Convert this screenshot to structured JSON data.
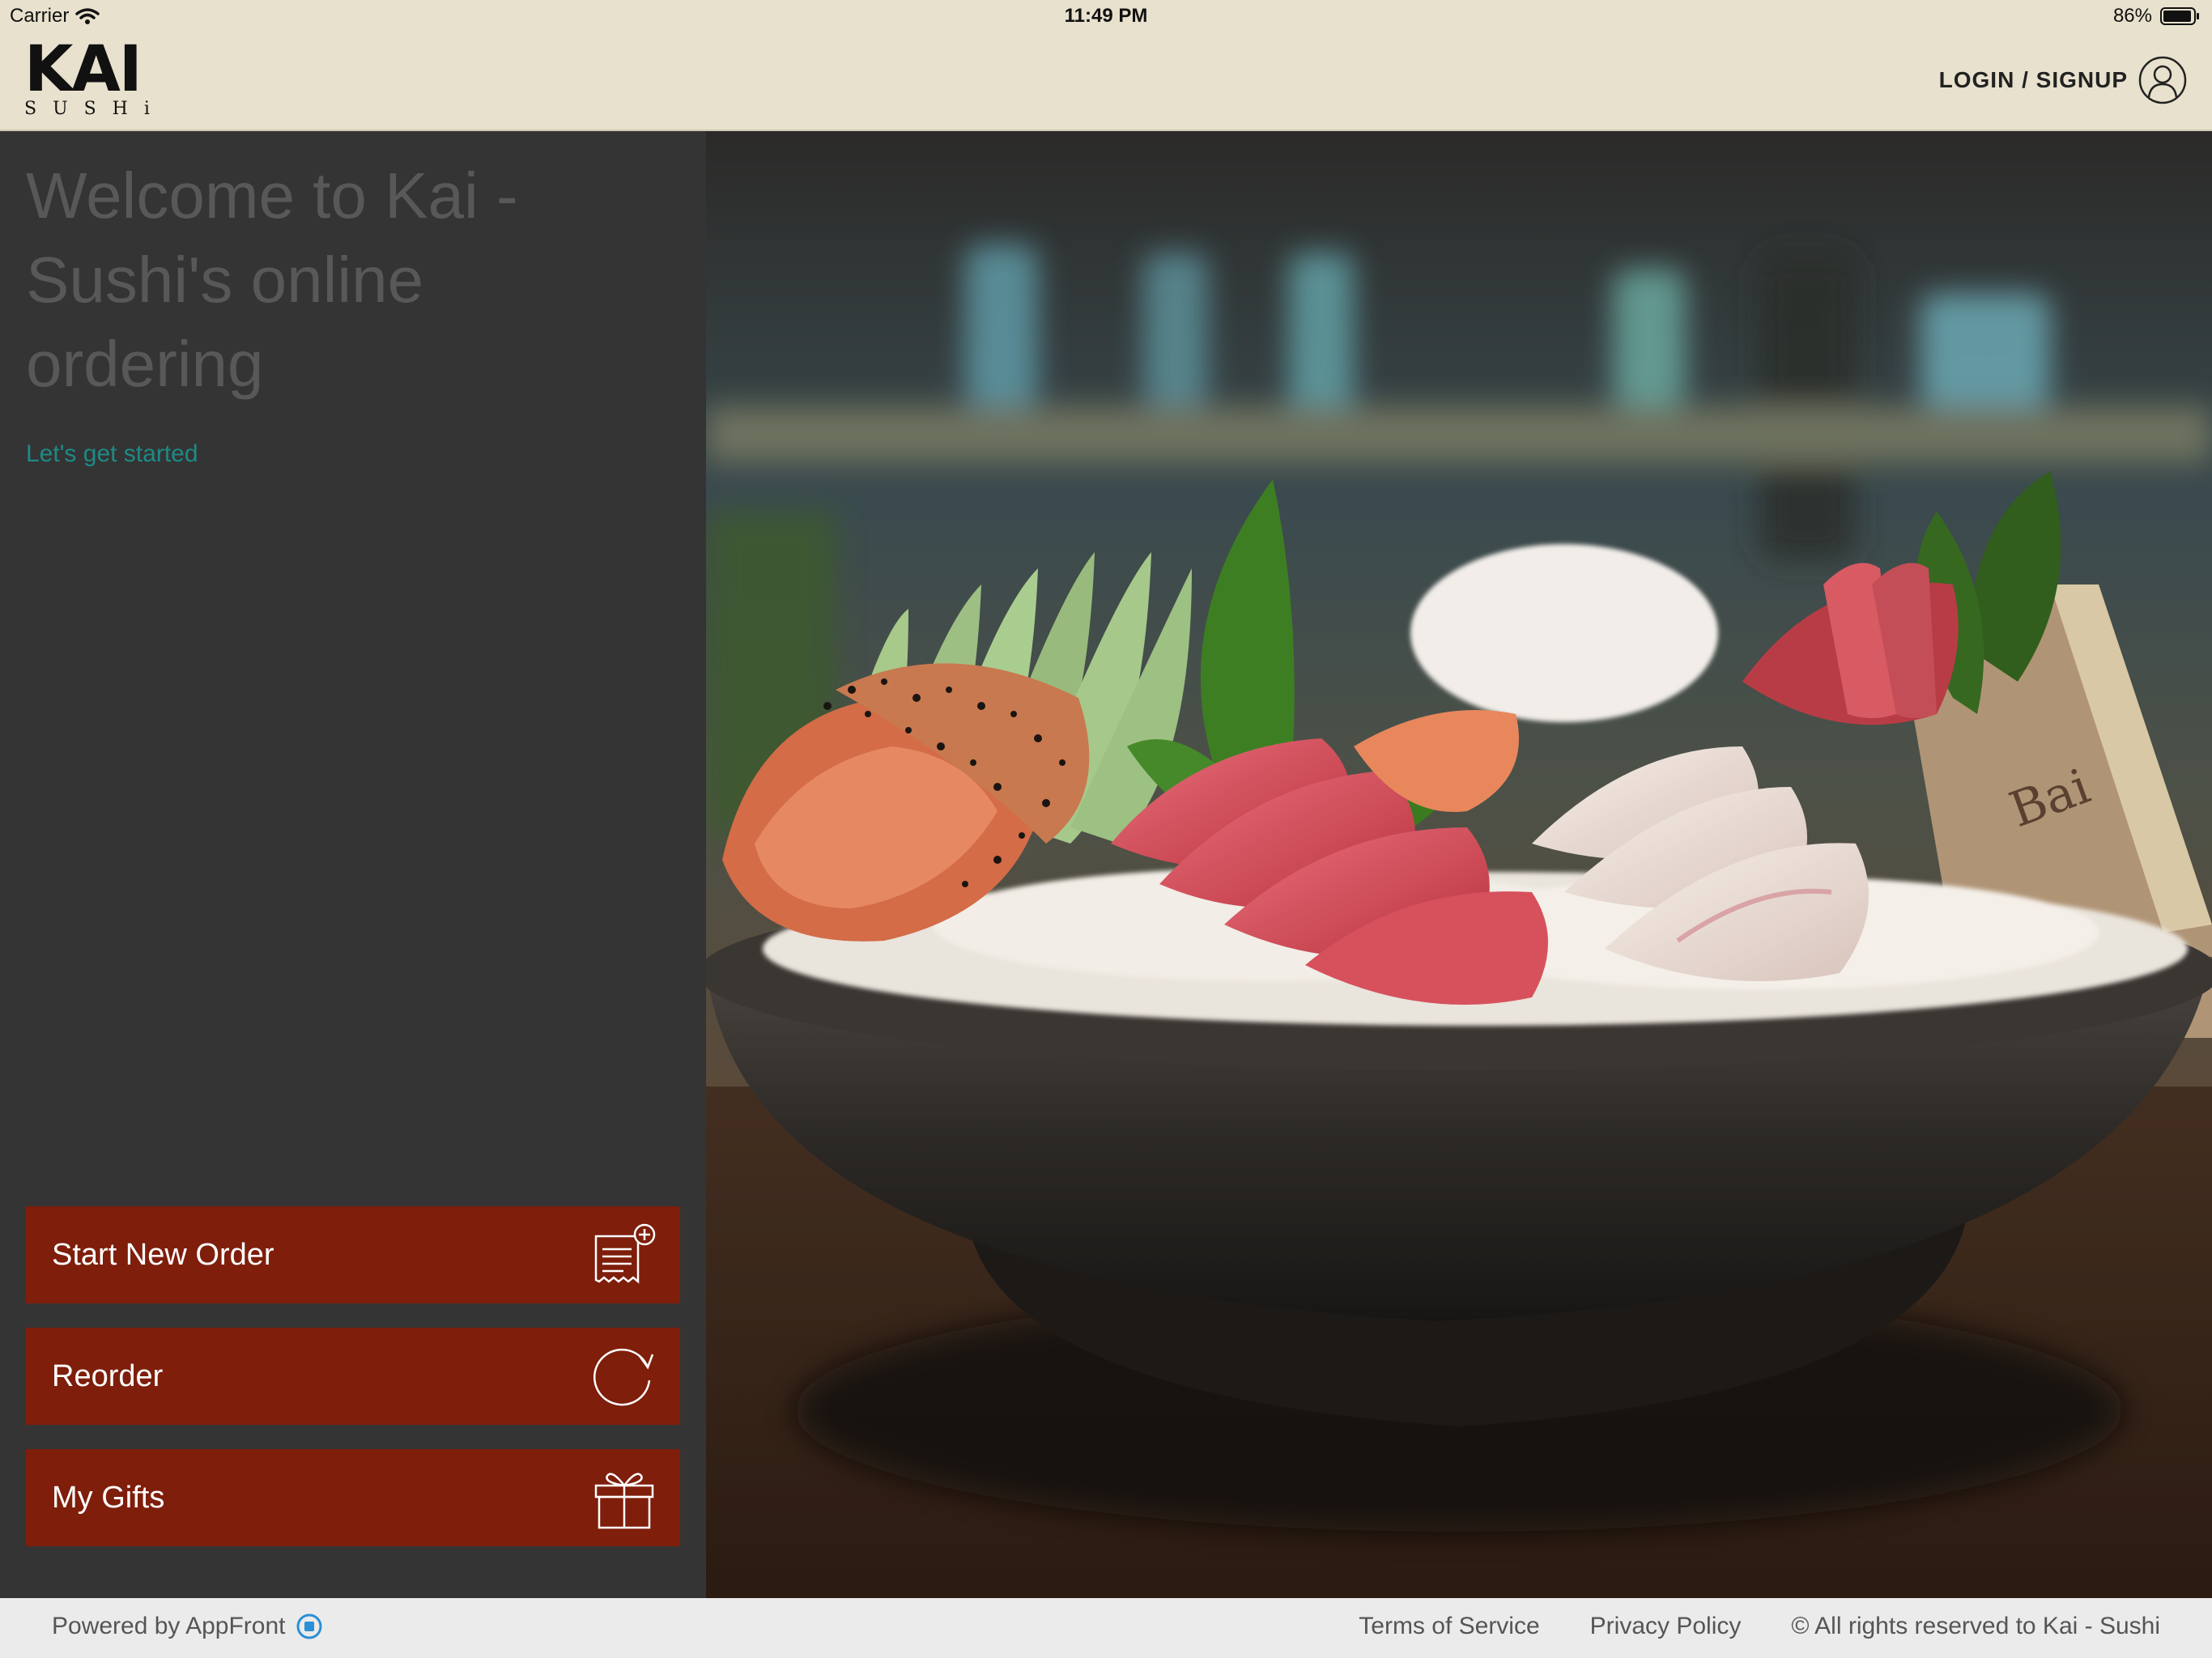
{
  "status_bar": {
    "carrier": "Carrier",
    "time": "11:49 PM",
    "battery": "86%"
  },
  "header": {
    "logo": {
      "title": "KAI",
      "subtitle": "SUSHi"
    },
    "login_label": "LOGIN / SIGNUP"
  },
  "main": {
    "welcome": "Welcome to Kai - Sushi's online ordering",
    "get_started": "Let's get started"
  },
  "actions": {
    "start_new_order": "Start New Order",
    "reorder": "Reorder",
    "my_gifts": "My Gifts"
  },
  "hero": {
    "box_text": "Bai"
  },
  "footer": {
    "powered_by": "Powered by AppFront",
    "terms": "Terms of Service",
    "privacy": "Privacy Policy",
    "rights": "© All rights reserved to Kai - Sushi"
  },
  "colors": {
    "header_bg": "#e8e1cd",
    "panel_bg": "#343434",
    "button_bg": "#7e1e0b",
    "link": "#1e8a86",
    "footer_bg": "#ebebeb"
  }
}
